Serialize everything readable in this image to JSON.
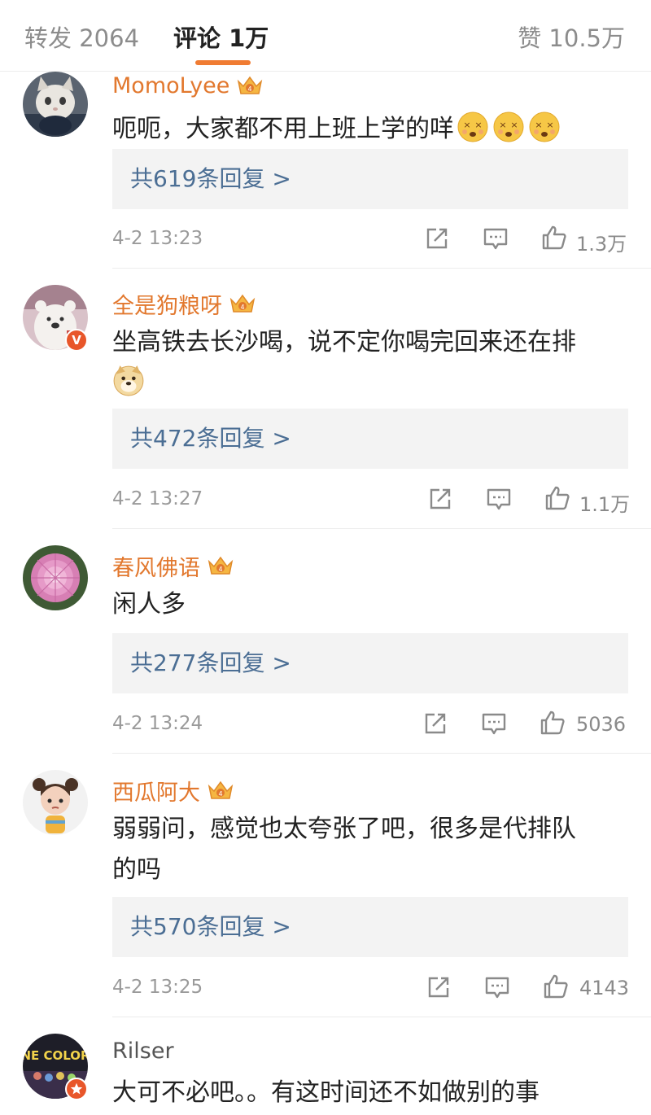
{
  "tabs": {
    "forward": "转发 2064",
    "comments": "评论 1万",
    "likes": "赞 10.5万"
  },
  "colors": {
    "username": "#e2782e",
    "reply_link": "#4b6e94",
    "accent_underline": "#f07c33",
    "badge": "#e8562a"
  },
  "comments": [
    {
      "username": "MomoLyee",
      "vip": true,
      "text": "呃呃，大家都不用上班上学的咩",
      "emojis": [
        "dizzy-face-emoji",
        "dizzy-face-emoji",
        "dizzy-face-emoji"
      ],
      "replies": "共619条回复 >",
      "time": "4-2 13:23",
      "likes": "1.3万"
    },
    {
      "username": "全是狗粮呀",
      "vip": true,
      "verified": "V",
      "text_line1": "坐高铁去长沙喝，说不定你喝完回来还在排",
      "emojis": [
        "doge-emoji"
      ],
      "replies": "共472条回复 >",
      "time": "4-2 13:27",
      "likes": "1.1万"
    },
    {
      "username": "春风佛语",
      "vip": true,
      "text": "闲人多",
      "replies": "共277条回复 >",
      "time": "4-2 13:24",
      "likes": "5036"
    },
    {
      "username": "西瓜阿大",
      "vip": true,
      "text_line1": "弱弱问，感觉也太夸张了吧，很多是代排队",
      "text_line2": "的吗",
      "replies": "共570条回复 >",
      "time": "4-2 13:25",
      "likes": "4143"
    },
    {
      "username": "Rilser",
      "vip": false,
      "avatar_text": "NE COLOR",
      "text": "大可不必吧。。有这时间还不如做别的事"
    }
  ]
}
